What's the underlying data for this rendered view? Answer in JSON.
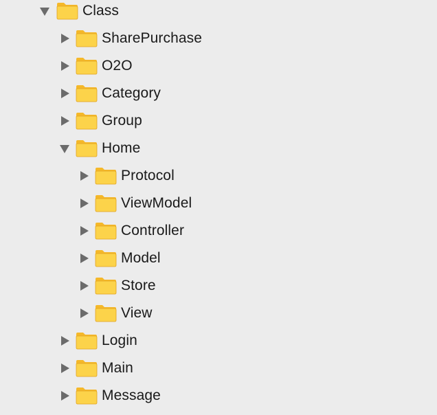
{
  "tree": {
    "root": {
      "label": "Class",
      "expanded": true,
      "icon": "folder-icon",
      "disclosure_icon": "triangle-down-icon"
    },
    "level1": [
      {
        "label": "SharePurchase",
        "expanded": false
      },
      {
        "label": "O2O",
        "expanded": false
      },
      {
        "label": "Category",
        "expanded": false
      },
      {
        "label": "Group",
        "expanded": false
      },
      {
        "label": "Home",
        "expanded": true
      },
      {
        "label": "Login",
        "expanded": false
      },
      {
        "label": "Main",
        "expanded": false
      },
      {
        "label": "Message",
        "expanded": false
      }
    ],
    "home_children": [
      {
        "label": "Protocol",
        "expanded": false
      },
      {
        "label": "ViewModel",
        "expanded": false
      },
      {
        "label": "Controller",
        "expanded": false
      },
      {
        "label": "Model",
        "expanded": false
      },
      {
        "label": "Store",
        "expanded": false
      },
      {
        "label": "View",
        "expanded": false
      }
    ]
  },
  "colors": {
    "background": "#ececec",
    "folder_body": "#fcd34a",
    "folder_tab": "#f5b82a",
    "folder_edge": "#e0a21f",
    "triangle": "#6b6b6b",
    "text": "#1a1a1a"
  }
}
